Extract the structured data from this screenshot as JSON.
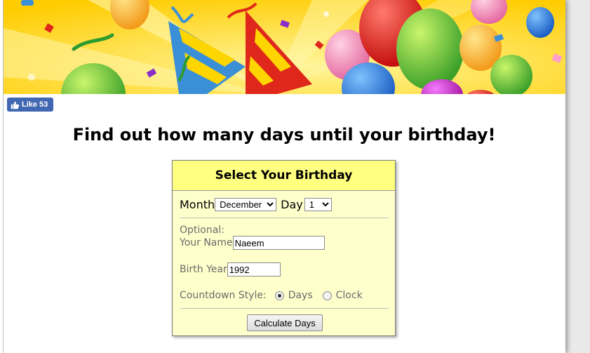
{
  "like": {
    "label": "Like",
    "count": "53"
  },
  "heading": "Find out how many days until your birthday!",
  "panel": {
    "title": "Select Your Birthday",
    "month_label": "Month",
    "month_value": "December",
    "day_label": "Day",
    "day_value": "1",
    "optional_label": "Optional:",
    "name_label": "Your Name",
    "name_value": "Naeem",
    "year_label": "Birth Year",
    "year_value": "1992",
    "style_label": "Countdown Style:",
    "style_options": [
      "Days",
      "Clock"
    ],
    "style_selected": "Days",
    "button_label": "Calculate Days"
  },
  "colors": {
    "panel_bg": "#ffffcc",
    "panel_header": "#ffff80",
    "like_blue": "#4267b2",
    "banner_yellow": "#ffd600"
  }
}
